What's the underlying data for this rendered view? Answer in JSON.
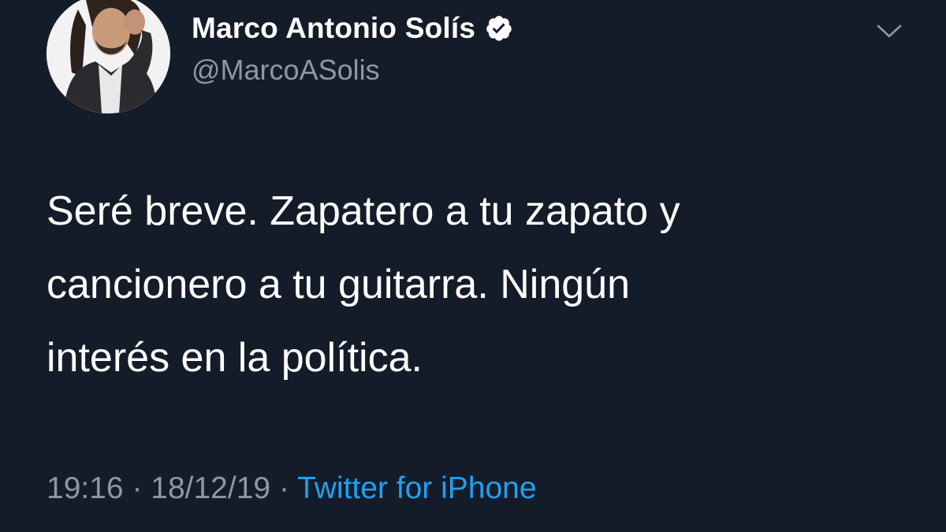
{
  "author": {
    "display_name": "Marco Antonio Solís",
    "handle": "@MarcoASolis",
    "verified": true,
    "avatar": "profile-photo"
  },
  "menu": {
    "icon": "chevron-down-icon"
  },
  "tweet": {
    "lines": [
      "Seré breve. Zapatero a tu zapato y",
      "cancionero a tu guitarra. Ningún",
      "interés en la política."
    ],
    "time": "19:16",
    "separator": "·",
    "date": "18/12/19",
    "source": "Twitter for iPhone"
  },
  "colors": {
    "background": "#151c29",
    "text": "#ffffff",
    "secondary_text": "#8b98a5",
    "link": "#1da1f2"
  }
}
